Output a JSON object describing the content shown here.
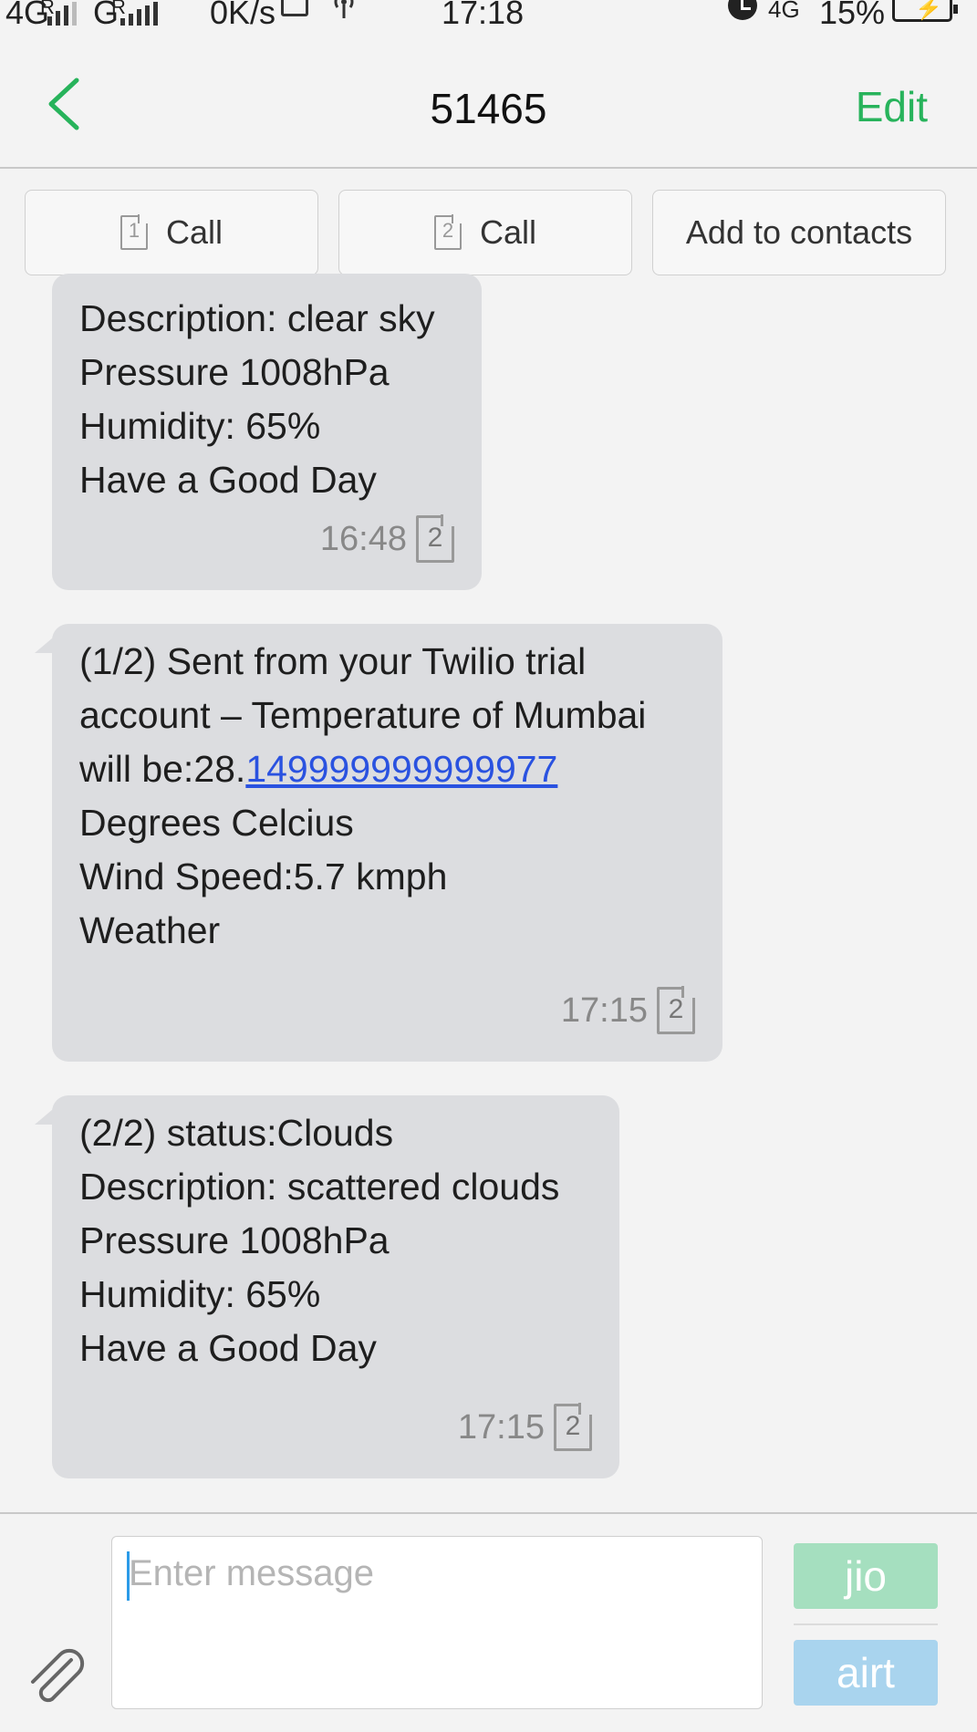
{
  "status_bar": {
    "net1": "4G",
    "net1_roaming": "R",
    "net2": "G",
    "net2_roaming": "R",
    "speed": "0K/s",
    "time": "17:18",
    "net3": "4G",
    "battery": "15%"
  },
  "header": {
    "title": "51465",
    "edit_label": "Edit"
  },
  "actions": {
    "call1_label": "Call",
    "call1_sim": "1",
    "call2_label": "Call",
    "call2_sim": "2",
    "add_contact_label": "Add to contacts"
  },
  "messages": [
    {
      "lines": [
        "Description: clear sky",
        "Pressure 1008hPa",
        "Humidity: 65%",
        "Have a Good Day"
      ],
      "time": "16:48",
      "sim": "2"
    },
    {
      "lines": [
        "(1/2) Sent from your Twilio trial",
        "account – Temperature of Mumbai",
        "will be:28.",
        "Degrees Celcius",
        "Wind Speed:5.7 kmph",
        "Weather"
      ],
      "link": "149999999999977",
      "time": "17:15",
      "sim": "2"
    },
    {
      "lines": [
        "(2/2) status:Clouds",
        "Description: scattered clouds",
        "Pressure 1008hPa",
        "Humidity: 65%",
        "Have a Good Day"
      ],
      "time": "17:15",
      "sim": "2"
    }
  ],
  "composer": {
    "placeholder": "Enter message",
    "send_sim1_label": "jio",
    "send_sim2_label": "airt"
  },
  "colors": {
    "accent": "#27b35b",
    "bubble": "#dcdde0",
    "link": "#2a52e0",
    "send_sim1": "#a5dfbf",
    "send_sim2": "#a9d4ee"
  }
}
